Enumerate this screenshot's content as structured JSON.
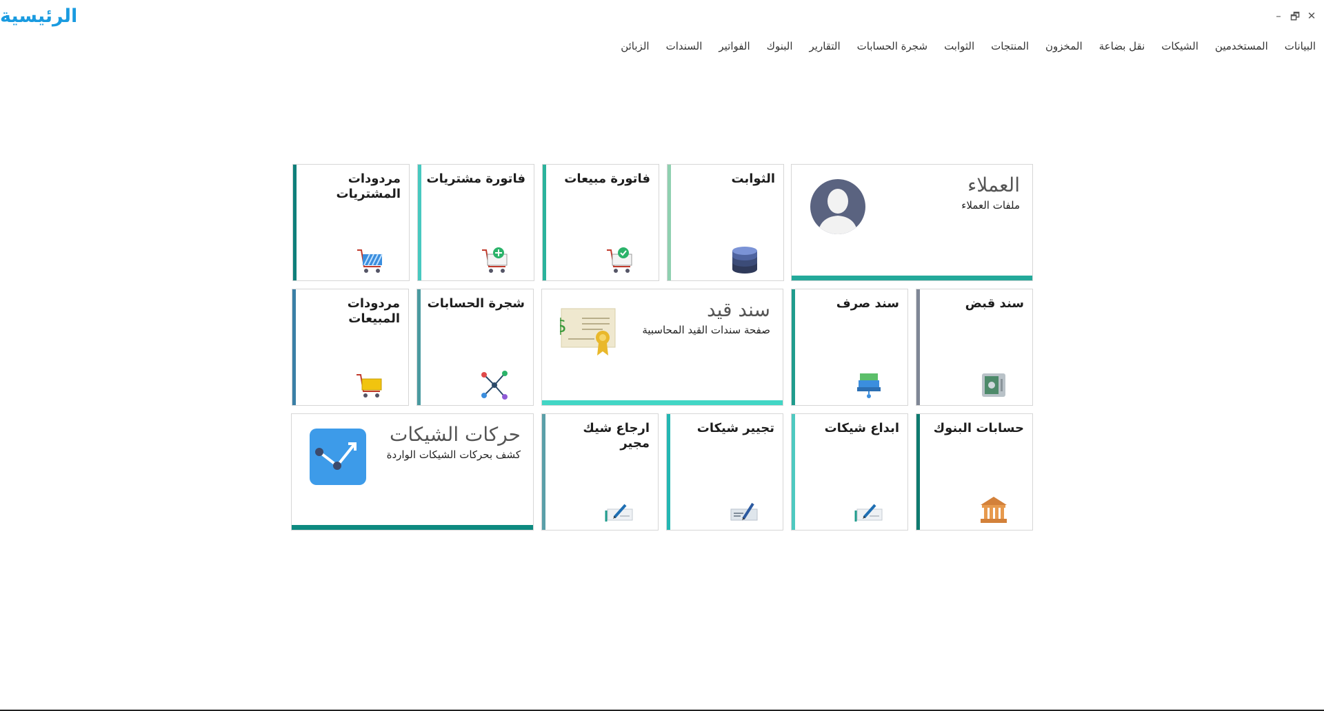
{
  "app": {
    "title": "الرئيسية"
  },
  "window_controls": {
    "minimize": "–",
    "restore": "🗗",
    "close": "✕"
  },
  "menu": [
    "الزبائن",
    "السندات",
    "الفواتير",
    "البنوك",
    "التقارير",
    "شجرة الحسابات",
    "الثوابت",
    "المنتجات",
    "المخزون",
    "نقل بضاعة",
    "الشيكات",
    "المستخدمين",
    "البيانات"
  ],
  "tiles": {
    "customers": {
      "title": "العملاء",
      "subtitle": "ملفات العملاء",
      "icon": "user-avatar-icon",
      "accent": "#23a99a"
    },
    "constants": {
      "title": "الثوابت",
      "icon": "database-icon",
      "accent": "#8fd0b0"
    },
    "sales_invoice": {
      "title": "فاتورة مبيعات",
      "icon": "cart-check-icon",
      "accent": "#2bb39c"
    },
    "purchase_invoice": {
      "title": "فاتورة مشتريات",
      "icon": "cart-add-icon",
      "accent": "#48c9c0"
    },
    "purchase_returns": {
      "title": "مردودات المشتريات",
      "icon": "cart-striped-icon",
      "accent": "#0f7f7a"
    },
    "receipt_voucher": {
      "title": "سند قبض",
      "icon": "safe-icon",
      "accent": "#7f8796"
    },
    "payment_voucher": {
      "title": "سند صرف",
      "icon": "cash-register-icon",
      "accent": "#1f9c8d"
    },
    "journal_voucher": {
      "title": "سند قيد",
      "subtitle": "صفحة سندات القيد المحاسبية",
      "icon": "certificate-icon",
      "accent": "#42d6c5"
    },
    "chart_of_accounts": {
      "title": "شجرة الحسابات",
      "icon": "network-icon",
      "accent": "#4a9aa0"
    },
    "sales_returns": {
      "title": "مردودات المبيعات",
      "icon": "cart-yellow-icon",
      "accent": "#3a7fa6"
    },
    "bank_accounts": {
      "title": "حسابات البنوك",
      "icon": "bank-icon",
      "accent": "#0e7a6f"
    },
    "cheque_deposit": {
      "title": "ابداع شيكات",
      "icon": "cheque-pen-icon",
      "accent": "#4ec9c0"
    },
    "cheque_endorse": {
      "title": "تجيير شيكات",
      "icon": "cheque-sign-icon",
      "accent": "#24b7b3"
    },
    "return_endorsed": {
      "title": "ارجاع شيك مجير",
      "icon": "cheque-pen-icon",
      "accent": "#5a9fa8"
    },
    "cheque_movements": {
      "title": "حركات الشيكات",
      "subtitle": "كشف بحركات الشيكات الواردة",
      "icon": "trend-chart-icon",
      "accent": "#0d8a80"
    }
  }
}
